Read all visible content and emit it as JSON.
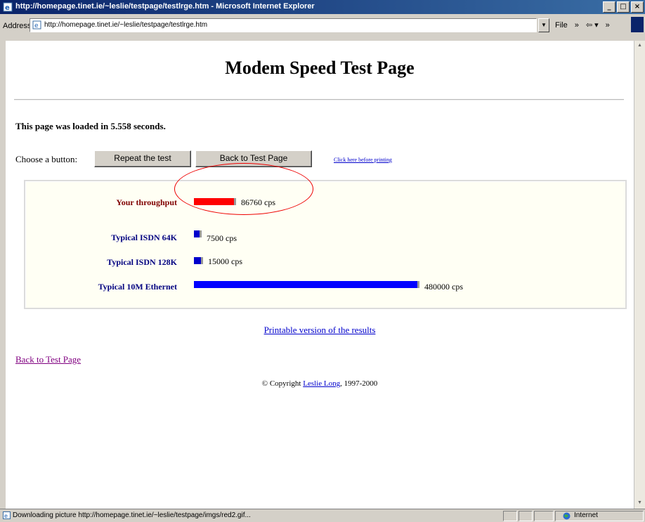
{
  "window": {
    "title": "http://homepage.tinet.ie/~leslie/testpage/testlrge.htm - Microsoft Internet Explorer",
    "buttons": {
      "minimize": "_",
      "maximize": "□",
      "close": "×"
    }
  },
  "addressbar": {
    "label": "Address",
    "url": "http://homepage.tinet.ie/~leslie/testpage/testlrge.htm",
    "menu_file": "File",
    "chevron": "»"
  },
  "page": {
    "title": "Modem Speed Test Page",
    "loaded_text": "This page was loaded in 5.558 seconds.",
    "choose_label": "Choose a button:",
    "repeat_button": "Repeat the test",
    "back_button": "Back to Test Page",
    "print_link": "Click here before printing",
    "printable_link": "Printable version of the results",
    "back_link": "Back to Test Page",
    "copyright_prefix": "© Copyright ",
    "copyright_name": "Leslie Long",
    "copyright_suffix": ", 1997-2000"
  },
  "results": [
    {
      "label": "Your throughput",
      "value": "86760 cps",
      "cps": 86760,
      "color": "#ff0000",
      "label_color": "#800000"
    },
    {
      "label": "Typical ISDN 64K",
      "value": "7500 cps",
      "cps": 7500,
      "color": "#0000cc",
      "label_color": "#000080"
    },
    {
      "label": "Typical ISDN 128K",
      "value": "15000 cps",
      "cps": 15000,
      "color": "#0000cc",
      "label_color": "#000080"
    },
    {
      "label": "Typical 10M Ethernet",
      "value": "480000 cps",
      "cps": 480000,
      "color": "#0000ff",
      "label_color": "#000080"
    }
  ],
  "status": {
    "text": "Downloading picture http://homepage.tinet.ie/~leslie/testpage/imgs/red2.gif...",
    "zone": "Internet"
  }
}
